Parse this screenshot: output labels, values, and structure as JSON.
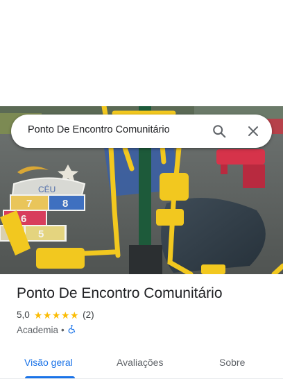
{
  "search": {
    "query": "Ponto De Encontro Comunitário"
  },
  "place": {
    "name": "Ponto De Encontro Comunitário",
    "rating": "5,0",
    "stars": 5,
    "review_count": "(2)",
    "category": "Academia",
    "separator": "•",
    "accessible_icon": "wheelchair-icon"
  },
  "tabs": [
    {
      "label": "Visão geral",
      "active": true
    },
    {
      "label": "Avaliações",
      "active": false
    },
    {
      "label": "Sobre",
      "active": false
    }
  ],
  "photo": {
    "hopscotch_word": "CÉU",
    "hopscotch_numbers": [
      "8",
      "7",
      "6",
      "5"
    ]
  },
  "colors": {
    "accent": "#1a73e8",
    "star": "#fbbc04",
    "equipment_yellow": "#f2c81f",
    "pole_green": "#1d5a3a",
    "bench_red": "#d6334a"
  }
}
